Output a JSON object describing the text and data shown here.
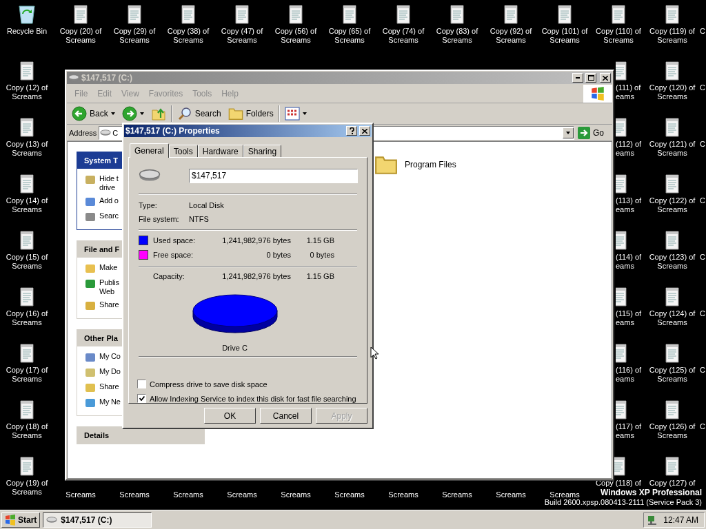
{
  "desktop": {
    "top_row": [
      {
        "kind": "recycle-bin",
        "label": "Recycle Bin"
      },
      {
        "kind": "document",
        "label": "Copy (20) of Screams"
      },
      {
        "kind": "document",
        "label": "Copy (29) of Screams"
      },
      {
        "kind": "document",
        "label": "Copy (38) of Screams"
      },
      {
        "kind": "document",
        "label": "Copy (47) of Screams"
      },
      {
        "kind": "document",
        "label": "Copy (56) of Screams"
      },
      {
        "kind": "document",
        "label": "Copy (65) of Screams"
      },
      {
        "kind": "document",
        "label": "Copy (74) of Screams"
      },
      {
        "kind": "document",
        "label": "Copy (83) of Screams"
      },
      {
        "kind": "document",
        "label": "Copy (92) of Screams"
      },
      {
        "kind": "document",
        "label": "Copy (101) of Screams"
      },
      {
        "kind": "document",
        "label": "Copy (110) of Screams"
      },
      {
        "kind": "document",
        "label": "Copy (119) of Screams"
      }
    ],
    "left_column": [
      {
        "kind": "document",
        "label": "Copy (12) of Screams"
      },
      {
        "kind": "document",
        "label": "Copy (13) of Screams"
      },
      {
        "kind": "document",
        "label": "Copy (14) of Screams"
      },
      {
        "kind": "document",
        "label": "Copy (15) of Screams"
      },
      {
        "kind": "document",
        "label": "Copy (16) of Screams"
      },
      {
        "kind": "document",
        "label": "Copy (17) of Screams"
      },
      {
        "kind": "document",
        "label": "Copy (18) of Screams"
      },
      {
        "kind": "document",
        "label": "Copy (19) of Screams"
      }
    ],
    "covered_column": [
      {
        "kind": "covered",
        "label": "(111) of\neams"
      },
      {
        "kind": "covered",
        "label": "(112) of\neams"
      },
      {
        "kind": "covered",
        "label": "(113) of\neams"
      },
      {
        "kind": "covered",
        "label": "(114) of\neams"
      },
      {
        "kind": "covered",
        "label": "(115) of\neams"
      },
      {
        "kind": "covered",
        "label": "(116) of\neams"
      },
      {
        "kind": "covered",
        "label": "(117) of\neams"
      }
    ],
    "right_column": [
      {
        "kind": "document",
        "label": "Copy (120) of Screams"
      },
      {
        "kind": "document",
        "label": "Copy (121) of Screams"
      },
      {
        "kind": "document",
        "label": "Copy (122) of Screams"
      },
      {
        "kind": "document",
        "label": "Copy (123) of Screams"
      },
      {
        "kind": "document",
        "label": "Copy (124) of Screams"
      },
      {
        "kind": "document",
        "label": "Copy (125) of Screams"
      },
      {
        "kind": "document",
        "label": "Copy (126) of Screams"
      },
      {
        "kind": "document",
        "label": "Copy (127) of"
      }
    ],
    "bottom_row": [
      {
        "kind": "label-only",
        "label": "Screams"
      },
      {
        "kind": "label-only",
        "label": "Screams"
      },
      {
        "kind": "label-only",
        "label": "Screams"
      },
      {
        "kind": "label-only",
        "label": "Screams"
      },
      {
        "kind": "label-only",
        "label": "Screams"
      },
      {
        "kind": "label-only",
        "label": "Screams"
      },
      {
        "kind": "label-only",
        "label": "Screams"
      },
      {
        "kind": "label-only",
        "label": "Screams"
      },
      {
        "kind": "label-only",
        "label": "Screams"
      },
      {
        "kind": "label-only",
        "label": "Screams"
      },
      {
        "kind": "document",
        "label": "Copy (118) of"
      }
    ],
    "edge_column": [
      {
        "kind": "edge",
        "label": "C"
      },
      {
        "kind": "edge",
        "label": "C"
      },
      {
        "kind": "edge",
        "label": "C"
      },
      {
        "kind": "edge",
        "label": "C"
      },
      {
        "kind": "edge",
        "label": "C"
      },
      {
        "kind": "edge",
        "label": "C"
      },
      {
        "kind": "edge",
        "label": "C"
      },
      {
        "kind": "edge",
        "label": "C"
      }
    ]
  },
  "explorer": {
    "title": "$147,517 (C:)",
    "menu": [
      "File",
      "Edit",
      "View",
      "Favorites",
      "Tools",
      "Help"
    ],
    "toolbar": [
      {
        "kind": "back",
        "label": "Back"
      },
      {
        "kind": "forward"
      },
      {
        "kind": "up"
      },
      {
        "kind": "separator"
      },
      {
        "kind": "search",
        "label": "Search"
      },
      {
        "kind": "folders",
        "label": "Folders"
      },
      {
        "kind": "separator"
      },
      {
        "kind": "views"
      }
    ],
    "address": {
      "label": "Address",
      "value": "C",
      "go": "Go"
    },
    "task_pane": [
      {
        "kind": "primary",
        "title": "System T",
        "items": [
          "Hide t\ndrive",
          "Add o",
          "Searc"
        ]
      },
      {
        "kind": "secondary",
        "title": "File and F",
        "items": [
          "Make",
          "Publis\nWeb",
          "Share"
        ]
      },
      {
        "kind": "secondary",
        "title": "Other Pla",
        "items": [
          "My Co",
          "My Do",
          "Share",
          "My Ne"
        ]
      },
      {
        "kind": "collapsed",
        "title": "Details"
      }
    ],
    "files": [
      {
        "label": "Program Files"
      }
    ]
  },
  "properties": {
    "title": "$147,517 (C:) Properties",
    "tabs": [
      {
        "label": "General",
        "selected": true
      },
      {
        "label": "Tools",
        "selected": false
      },
      {
        "label": "Hardware",
        "selected": false
      },
      {
        "label": "Sharing",
        "selected": false
      }
    ],
    "name": "$147,517",
    "info": [
      {
        "label": "Type:",
        "value": "Local Disk"
      },
      {
        "label": "File system:",
        "value": "NTFS"
      }
    ],
    "space": [
      {
        "label": "Used space:",
        "color": "#0000ff",
        "bytes": "1,241,982,976 bytes",
        "size": "1.15 GB"
      },
      {
        "label": "Free space:",
        "color": "#ff00ff",
        "bytes": "0 bytes",
        "size": "0 bytes"
      }
    ],
    "capacity": {
      "label": "Capacity:",
      "bytes": "1,241,982,976 bytes",
      "size": "1.15 GB"
    },
    "drive_label": "Drive C",
    "options": [
      {
        "label": "Compress drive to save disk space",
        "checked": false
      },
      {
        "label": "Allow Indexing Service to index this disk for fast file searching",
        "checked": true
      }
    ],
    "buttons": [
      {
        "label": "OK",
        "disabled": false
      },
      {
        "label": "Cancel",
        "disabled": false
      },
      {
        "label": "Apply",
        "disabled": true
      }
    ]
  },
  "taskbar": {
    "start": "Start",
    "tasks": [
      {
        "label": "$147,517 (C:)",
        "selected": true
      }
    ],
    "clock": "12:47 AM"
  },
  "os_notice": [
    "Windows XP Professional",
    "Build 2600.xpsp.080413-2111 (Service Pack 3)"
  ]
}
